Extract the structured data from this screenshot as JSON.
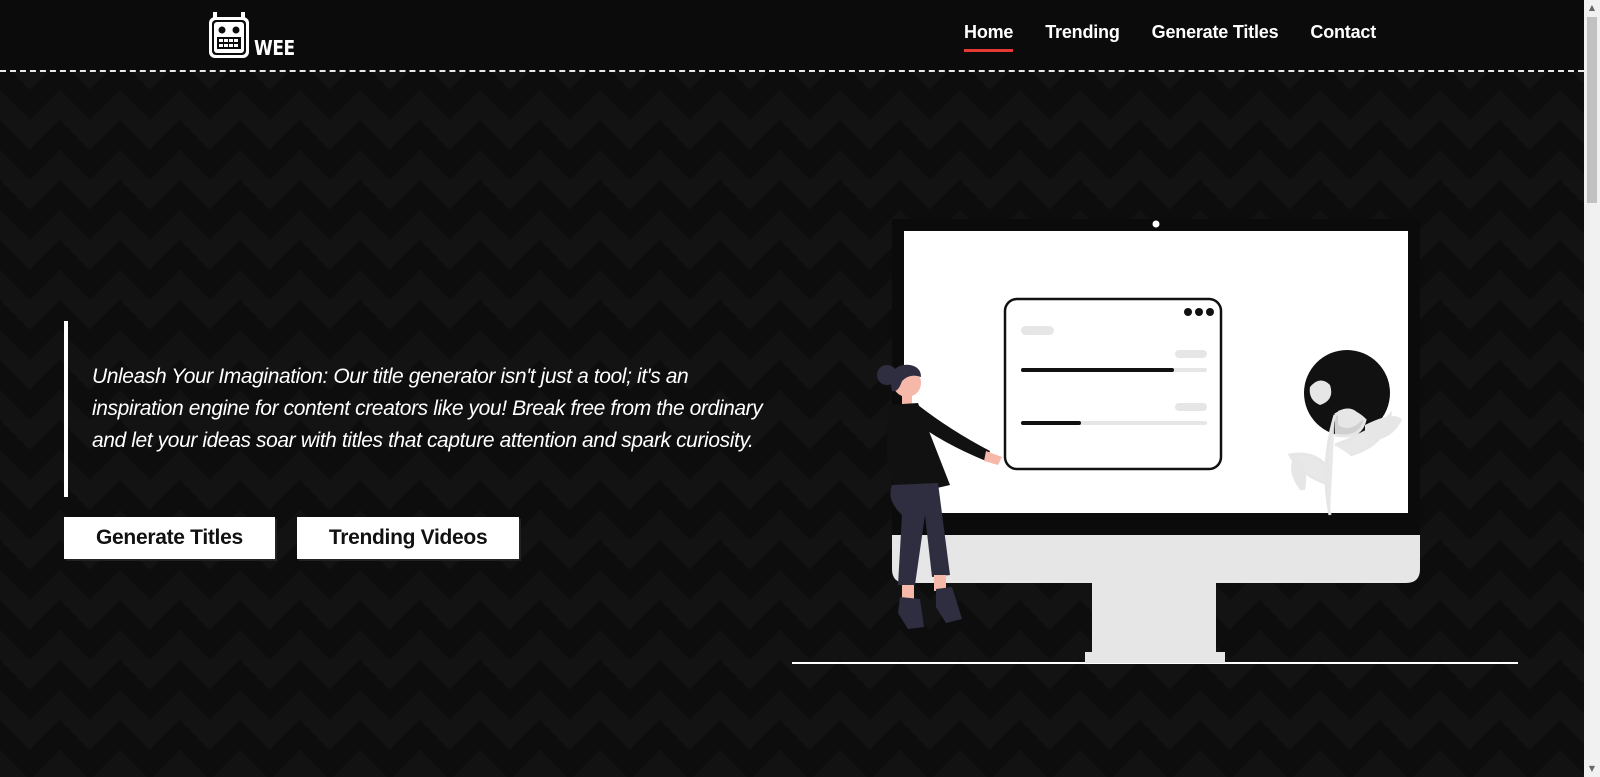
{
  "logo": {
    "text": "WEE",
    "icon": "robot-icon"
  },
  "nav": {
    "items": [
      {
        "label": "Home",
        "active": true
      },
      {
        "label": "Trending",
        "active": false
      },
      {
        "label": "Generate Titles",
        "active": false
      },
      {
        "label": "Contact",
        "active": false
      }
    ],
    "active_color": "#e53935"
  },
  "hero": {
    "quote": "Unleash Your Imagination: Our title generator isn't just a tool; it's an inspiration engine for content creators like you! Break free from the ordinary and let your ideas soar with titles that capture attention and spark curiosity.",
    "primary_button": "Generate Titles",
    "secondary_button": "Trending Videos"
  },
  "illustration": {
    "icon": "person-at-monitor-illustration",
    "dashboard_progress": [
      0.82,
      0.32
    ]
  },
  "colors": {
    "background": "#0d0d0d",
    "text": "#ffffff",
    "accent": "#e53935",
    "person_skin": "#f6b8a8",
    "person_dark": "#2f2e41"
  }
}
